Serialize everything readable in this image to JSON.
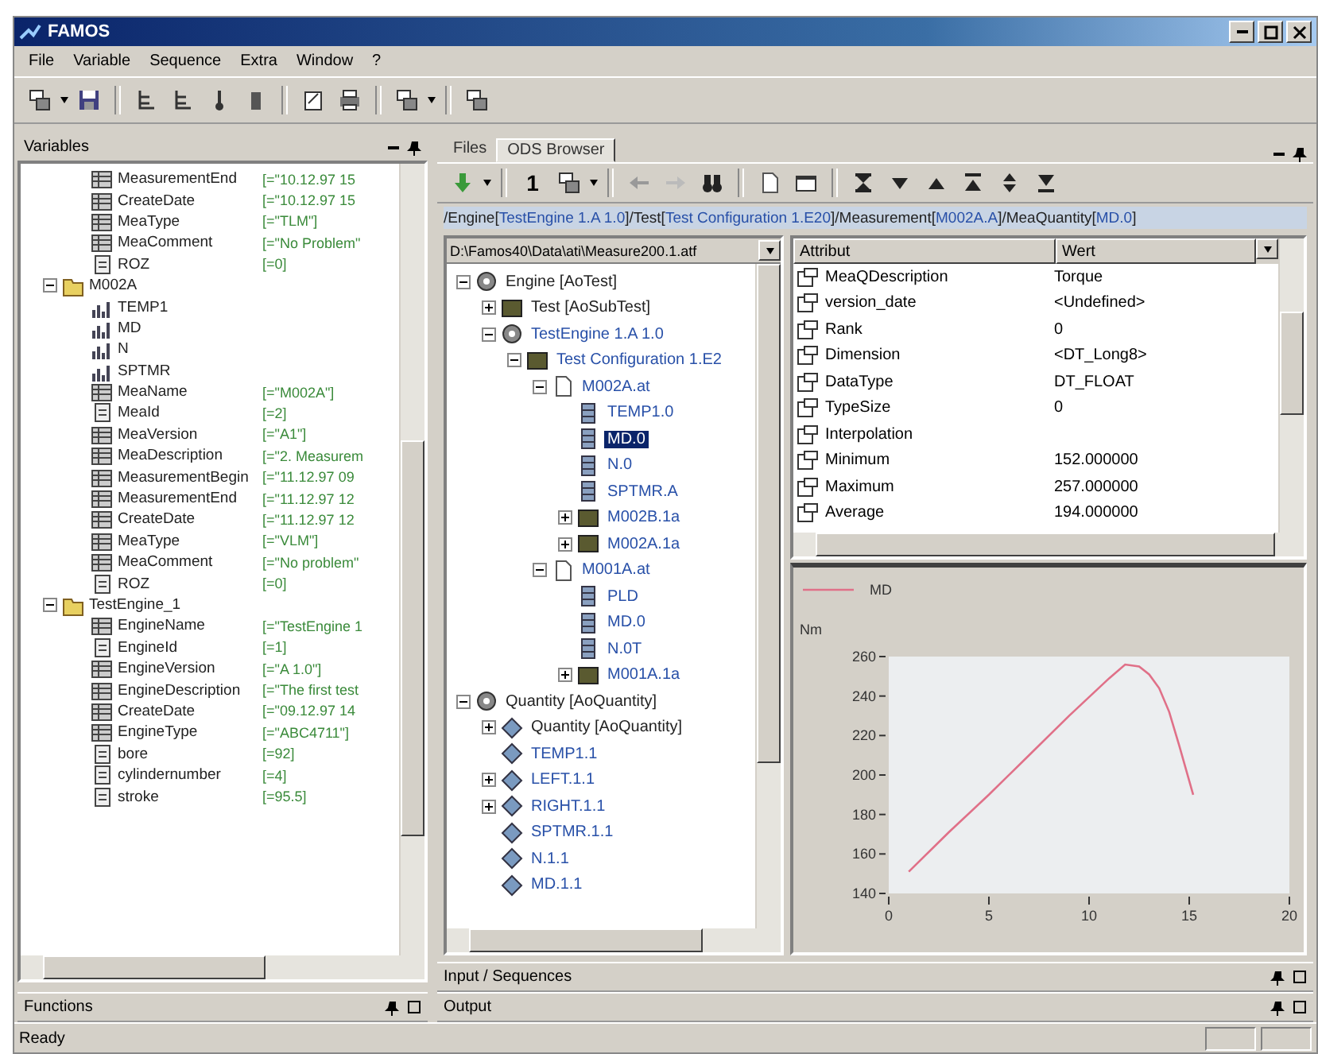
{
  "window": {
    "title": "FAMOS"
  },
  "menu": [
    "File",
    "Variable",
    "Sequence",
    "Extra",
    "Window",
    "?"
  ],
  "variables_panel": {
    "title": "Variables",
    "items": [
      {
        "kind": "continuation",
        "children": [
          {
            "kind": "text",
            "name": "MeasurementEnd",
            "value": "[=\"10.12.97 15"
          },
          {
            "kind": "text",
            "name": "CreateDate",
            "value": "[=\"10.12.97 15"
          },
          {
            "kind": "text",
            "name": "MeaType",
            "value": "[=\"TLM\"]"
          },
          {
            "kind": "text",
            "name": "MeaComment",
            "value": "[=\"No Problem\""
          },
          {
            "kind": "number",
            "name": "ROZ",
            "value": "[=0]"
          }
        ]
      },
      {
        "kind": "folder",
        "name": "M002A",
        "expanded": true,
        "children": [
          {
            "kind": "channel",
            "name": "TEMP1"
          },
          {
            "kind": "channel",
            "name": "MD"
          },
          {
            "kind": "channel",
            "name": "N"
          },
          {
            "kind": "channel",
            "name": "SPTMR"
          },
          {
            "kind": "text",
            "name": "MeaName",
            "value": "[=\"M002A\"]"
          },
          {
            "kind": "number",
            "name": "MeaId",
            "value": "[=2]"
          },
          {
            "kind": "text",
            "name": "MeaVersion",
            "value": "[=\"A1\"]"
          },
          {
            "kind": "text",
            "name": "MeaDescription",
            "value": "[=\"2. Measurem"
          },
          {
            "kind": "text",
            "name": "MeasurementBegin",
            "value": "[=\"11.12.97 09"
          },
          {
            "kind": "text",
            "name": "MeasurementEnd",
            "value": "[=\"11.12.97 12"
          },
          {
            "kind": "text",
            "name": "CreateDate",
            "value": "[=\"11.12.97 12"
          },
          {
            "kind": "text",
            "name": "MeaType",
            "value": "[=\"VLM\"]"
          },
          {
            "kind": "text",
            "name": "MeaComment",
            "value": "[=\"No problem\""
          },
          {
            "kind": "number",
            "name": "ROZ",
            "value": "[=0]"
          }
        ]
      },
      {
        "kind": "folder",
        "name": "TestEngine_1",
        "expanded": true,
        "children": [
          {
            "kind": "text",
            "name": "EngineName",
            "value": "[=\"TestEngine 1"
          },
          {
            "kind": "number",
            "name": "EngineId",
            "value": "[=1]"
          },
          {
            "kind": "text",
            "name": "EngineVersion",
            "value": "[=\"A 1.0\"]"
          },
          {
            "kind": "text",
            "name": "EngineDescription",
            "value": "[=\"The first test"
          },
          {
            "kind": "text",
            "name": "CreateDate",
            "value": "[=\"09.12.97 14"
          },
          {
            "kind": "text",
            "name": "EngineType",
            "value": "[=\"ABC4711\"]"
          },
          {
            "kind": "number",
            "name": "bore",
            "value": "[=92]"
          },
          {
            "kind": "number",
            "name": "cylindernumber",
            "value": "[=4]"
          },
          {
            "kind": "number",
            "name": "stroke",
            "value": "[=95.5]"
          }
        ]
      }
    ]
  },
  "functions_panel": {
    "title": "Functions"
  },
  "browser": {
    "tabs": [
      {
        "label": "Files",
        "selected": false
      },
      {
        "label": "ODS Browser",
        "selected": true
      }
    ],
    "toolbar_label": "1",
    "path": [
      {
        "kind": "plain",
        "text": "/Engine["
      },
      {
        "kind": "link",
        "text": "TestEngine 1.A 1.0"
      },
      {
        "kind": "plain",
        "text": "]/Test["
      },
      {
        "kind": "link",
        "text": "Test Configuration 1.E20"
      },
      {
        "kind": "plain",
        "text": "]/Measurement["
      },
      {
        "kind": "link",
        "text": "M002A.A"
      },
      {
        "kind": "plain",
        "text": "]/MeaQuantity["
      },
      {
        "kind": "link",
        "text": "MD.0"
      },
      {
        "kind": "plain",
        "text": "]"
      }
    ],
    "file_selector": "D:\\Famos40\\Data\\ati\\Measure200.1.atf",
    "tree": [
      {
        "kind": "class",
        "label": "Engine [AoTest]",
        "expanded": true,
        "selected": false,
        "children": [
          {
            "kind": "subclass",
            "label": "Test [AoSubTest]",
            "expanded": false,
            "selected": false
          },
          {
            "kind": "instance",
            "label": "TestEngine 1.A 1.0",
            "expanded": true,
            "selected": false,
            "children": [
              {
                "kind": "config",
                "label": "Test Configuration 1.E2",
                "expanded": true,
                "selected": false,
                "children": [
                  {
                    "kind": "measurement",
                    "label": "M002A.at",
                    "expanded": true,
                    "selected": false,
                    "children": [
                      {
                        "kind": "channel",
                        "label": "TEMP1.0",
                        "selected": false
                      },
                      {
                        "kind": "channel",
                        "label": "MD.0",
                        "selected": true
                      },
                      {
                        "kind": "channel",
                        "label": "N.0",
                        "selected": false
                      },
                      {
                        "kind": "channel",
                        "label": "SPTMR.A",
                        "selected": false
                      },
                      {
                        "kind": "matrix",
                        "label": "M002B.1a",
                        "expanded": false,
                        "selected": false
                      },
                      {
                        "kind": "matrix",
                        "label": "M002A.1a",
                        "expanded": false,
                        "selected": false
                      }
                    ]
                  },
                  {
                    "kind": "measurement",
                    "label": "M001A.at",
                    "expanded": true,
                    "selected": false,
                    "children": [
                      {
                        "kind": "channel",
                        "label": "PLD",
                        "selected": false
                      },
                      {
                        "kind": "channel",
                        "label": "MD.0",
                        "selected": false
                      },
                      {
                        "kind": "channel",
                        "label": "N.0T",
                        "selected": false
                      },
                      {
                        "kind": "matrix",
                        "label": "M001A.1a",
                        "expanded": false,
                        "selected": false
                      }
                    ]
                  }
                ]
              }
            ]
          }
        ]
      },
      {
        "kind": "class",
        "label": "Quantity [AoQuantity]",
        "expanded": true,
        "selected": false,
        "children": [
          {
            "kind": "quantity_class",
            "label": "Quantity [AoQuantity]",
            "expanded": false,
            "selected": false
          },
          {
            "kind": "quantity",
            "label": "TEMP1.1",
            "selected": false
          },
          {
            "kind": "quantity",
            "label": "LEFT.1.1",
            "expanded": false,
            "selected": false
          },
          {
            "kind": "quantity",
            "label": "RIGHT.1.1",
            "expanded": false,
            "selected": false
          },
          {
            "kind": "quantity",
            "label": "SPTMR.1.1",
            "selected": false
          },
          {
            "kind": "quantity",
            "label": "N.1.1",
            "selected": false
          },
          {
            "kind": "quantity",
            "label": "MD.1.1",
            "selected": false
          }
        ]
      }
    ],
    "attributes": {
      "columns": [
        "Attribut",
        "Wert"
      ],
      "rows": [
        {
          "name": "MeaQDescription",
          "value": "Torque"
        },
        {
          "name": "version_date",
          "value": "<Undefined>"
        },
        {
          "name": "Rank",
          "value": "0"
        },
        {
          "name": "Dimension",
          "value": "<DT_Long8>"
        },
        {
          "name": "DataType",
          "value": "DT_FLOAT"
        },
        {
          "name": "TypeSize",
          "value": "0"
        },
        {
          "name": "Interpolation"
        },
        {
          "name": "Minimum",
          "value": "152.000000"
        },
        {
          "name": "Maximum",
          "value": "257.000000"
        },
        {
          "name": "Average",
          "value": "194.000000"
        }
      ]
    },
    "plot": {
      "chart_data": {
        "type": "line",
        "ylabel": "Nm",
        "x": [
          1,
          3,
          5,
          7,
          9,
          11,
          11.8,
          12.5,
          13,
          13.5,
          14,
          14.5,
          15.2
        ],
        "series": [
          {
            "name": "MD",
            "color": "#e07088",
            "values": [
              151,
              171,
              190,
              210,
              230,
              249,
              256,
              255,
              251,
              244,
              232,
              215,
              190
            ]
          }
        ],
        "xlim": [
          0,
          20
        ],
        "ylim": [
          140,
          260
        ],
        "xticks": [
          0,
          5,
          10,
          15,
          20
        ],
        "yticks": [
          140,
          160,
          180,
          200,
          220,
          240,
          260
        ]
      }
    }
  },
  "input_panel": {
    "title": "Input / Sequences"
  },
  "output_panel": {
    "title": "Output"
  },
  "status_bar": {
    "text": "Ready"
  }
}
